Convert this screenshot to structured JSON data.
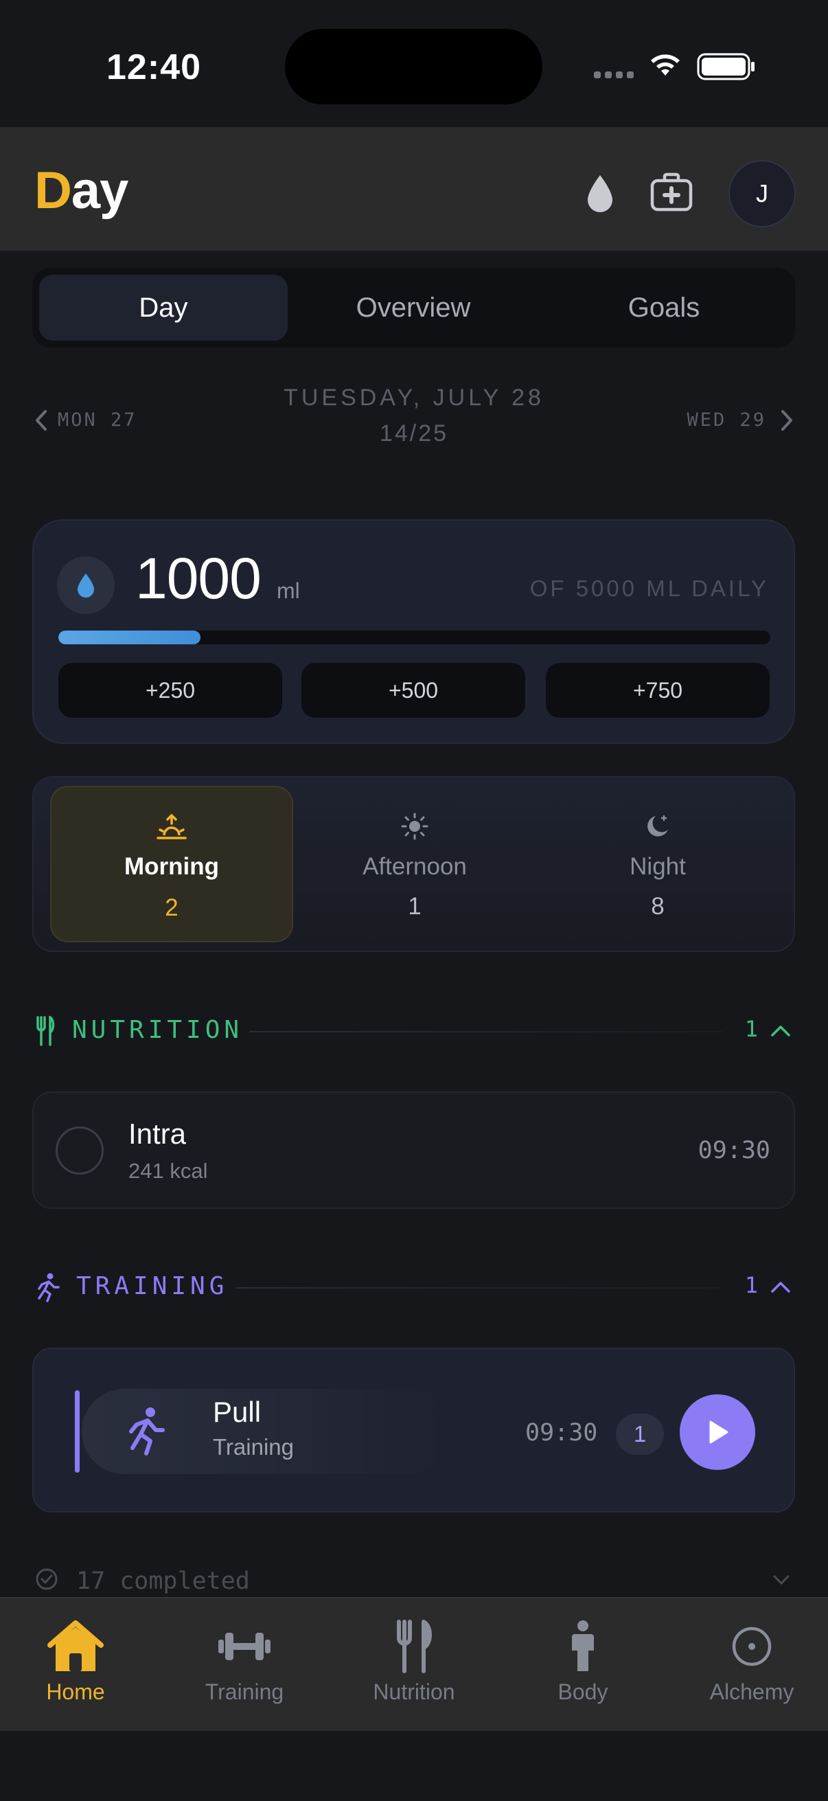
{
  "status_bar": {
    "time": "12:40"
  },
  "header": {
    "logo_first": "D",
    "logo_rest": "ay",
    "avatar_initial": "J",
    "icons": [
      "water-drop-icon",
      "first-aid-kit-icon"
    ]
  },
  "tabs": [
    "Day",
    "Overview",
    "Goals"
  ],
  "active_tab": "Day",
  "date_nav": {
    "prev": "MON 27",
    "title": "TUESDAY, JULY 28",
    "subtitle": "14/25",
    "next": "WED 29"
  },
  "water": {
    "value": "1000",
    "unit": "ml",
    "goal_label": "OF 5000 ML DAILY",
    "progress": 0.2,
    "buttons": [
      "+250",
      "+500",
      "+750"
    ],
    "accent": "#4b9be0"
  },
  "periods": [
    {
      "label": "Morning",
      "count": "2",
      "icon": "sunrise-icon",
      "active": true
    },
    {
      "label": "Afternoon",
      "count": "1",
      "icon": "sun-icon",
      "active": false
    },
    {
      "label": "Night",
      "count": "8",
      "icon": "moon-icon",
      "active": false
    }
  ],
  "nutrition": {
    "title": "NUTRITION",
    "count": "1",
    "color": "#3fbf7f",
    "items": [
      {
        "name": "Intra",
        "sub": "241 kcal",
        "time": "09:30"
      }
    ]
  },
  "training": {
    "title": "TRAINING",
    "count": "1",
    "color": "#8b7cf6",
    "items": [
      {
        "name": "Pull",
        "sub": "Training",
        "time": "09:30",
        "badge": "1"
      }
    ]
  },
  "completed": {
    "label": "17 completed"
  },
  "bottom_nav": [
    {
      "label": "Home",
      "icon": "home-icon",
      "active": true
    },
    {
      "label": "Training",
      "icon": "dumbbell-icon",
      "active": false
    },
    {
      "label": "Nutrition",
      "icon": "fork-knife-icon",
      "active": false
    },
    {
      "label": "Body",
      "icon": "person-icon",
      "active": false
    },
    {
      "label": "Alchemy",
      "icon": "target-circle-icon",
      "active": false
    }
  ],
  "accent_color": "#f0b429"
}
